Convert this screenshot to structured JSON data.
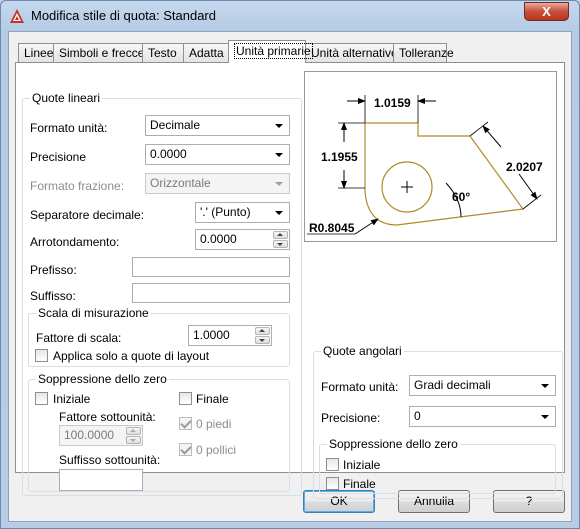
{
  "window": {
    "title": "Modifica stile di quota: Standard",
    "close_label": "X"
  },
  "tabs": [
    {
      "label": "Linee",
      "active": false
    },
    {
      "label": "Simboli e frecce",
      "active": false
    },
    {
      "label": "Testo",
      "active": false
    },
    {
      "label": "Adatta",
      "active": false
    },
    {
      "label": "Unità primarie",
      "active": true
    },
    {
      "label": "Unità alternative",
      "active": false
    },
    {
      "label": "Tolleranze",
      "active": false
    }
  ],
  "linear": {
    "group_title": "Quote lineari",
    "unit_format": {
      "label": "Formato unità:",
      "value": "Decimale"
    },
    "precision": {
      "label": "Precisione",
      "value": "0.0000"
    },
    "fraction_format": {
      "label": "Formato frazione:",
      "value": "Orizzontale"
    },
    "decimal_separator": {
      "label": "Separatore decimale:",
      "value": "'.' (Punto)"
    },
    "round_off": {
      "label": "Arrotondamento:",
      "value": "0.0000"
    },
    "prefix": {
      "label": "Prefisso:",
      "value": ""
    },
    "suffix": {
      "label": "Suffisso:",
      "value": ""
    }
  },
  "scale": {
    "group_title": "Scala di misurazione",
    "factor": {
      "label": "Fattore di scala:",
      "value": "1.0000"
    },
    "layout_only": {
      "label": "Applica solo a quote di layout",
      "checked": false
    }
  },
  "zero_linear": {
    "group_title": "Soppressione dello zero",
    "leading": {
      "label": "Iniziale",
      "checked": false
    },
    "trailing": {
      "label": "Finale",
      "checked": false
    },
    "sub_factor": {
      "label": "Fattore sottounità:",
      "value": "100.0000"
    },
    "sub_suffix": {
      "label": "Suffisso sottounità:",
      "value": ""
    },
    "feet": {
      "label": "0 piedi",
      "checked": true
    },
    "inches": {
      "label": "0 pollici",
      "checked": true
    }
  },
  "angular": {
    "group_title": "Quote angolari",
    "unit_format": {
      "label": "Formato unità:",
      "value": "Gradi decimali"
    },
    "precision": {
      "label": "Precisione:",
      "value": "0"
    },
    "zero_title": "Soppressione dello zero",
    "leading": {
      "label": "Iniziale",
      "checked": false
    },
    "trailing": {
      "label": "Finale",
      "checked": false
    }
  },
  "preview": {
    "dim_top": "1.0159",
    "dim_left": "1.1955",
    "dim_right": "2.0207",
    "dim_angle": "60°",
    "dim_radius": "R0.8045",
    "line_color": "#b08a2a"
  },
  "buttons": {
    "ok": "OK",
    "cancel": "Annulla",
    "help": "?"
  },
  "colors": {
    "accent": "#3c7fb1",
    "close_red": "#c7503a"
  }
}
